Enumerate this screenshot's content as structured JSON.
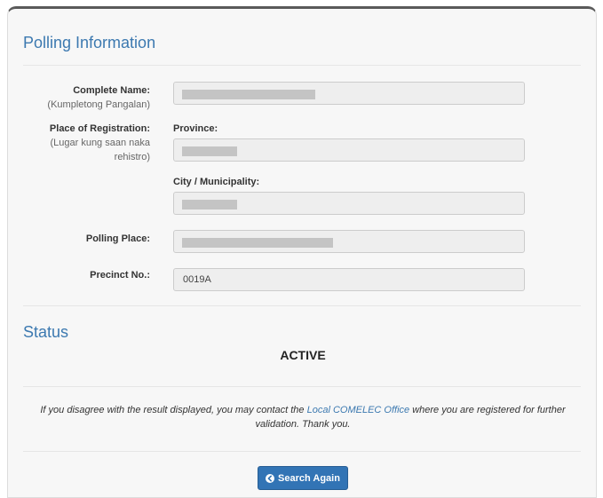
{
  "polling": {
    "title": "Polling Information",
    "complete_name": {
      "label": "Complete Name:",
      "sublabel": "(Kumpletong Pangalan)"
    },
    "place_of_registration": {
      "label": "Place of Registration:",
      "sublabel": "(Lugar kung saan naka rehistro)",
      "province_label": "Province:",
      "city_label": "City / Municipality:"
    },
    "polling_place": {
      "label": "Polling Place:"
    },
    "precinct": {
      "label": "Precinct No.:",
      "value": "0019A"
    }
  },
  "status": {
    "title": "Status",
    "value": "ACTIVE"
  },
  "note": {
    "before": "If you disagree with the result displayed, you may contact the ",
    "link": "Local COMELEC Office",
    "after": " where you are registered for further validation. Thank you."
  },
  "actions": {
    "search_again_label": "Search Again",
    "search_again_icon": "circle-arrow-left-icon"
  },
  "colors": {
    "accent": "#3c79b0",
    "button": "#3274b5"
  }
}
